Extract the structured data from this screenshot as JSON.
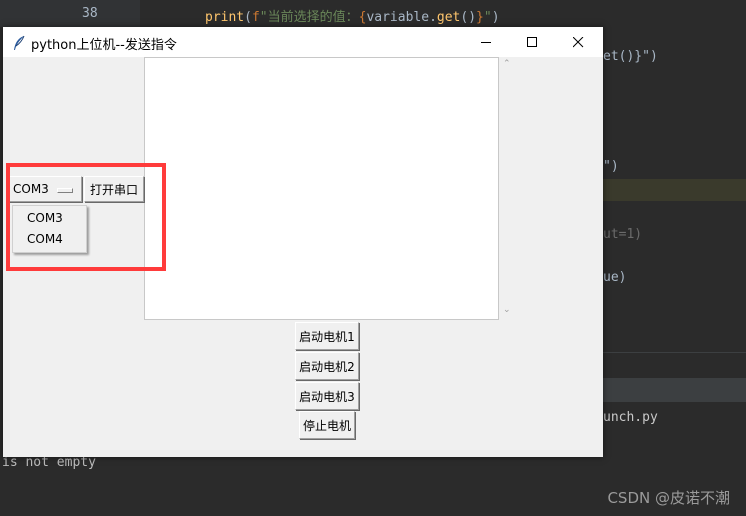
{
  "ide": {
    "line_number": "38",
    "code_top": {
      "fn": "print",
      "open": "(",
      "fprefix": "f",
      "str_open": "\"当前选择的值：",
      "brace_l": "{",
      "var": "variable",
      "dot": ".",
      "meth": "get",
      "call": "()",
      "brace_r": "}",
      "str_close": "\"",
      "close": ")"
    },
    "code_right_1": "et()}\")",
    "code_right_2": "\")",
    "code_right_3": "ut=1)",
    "code_right_4": "ue)",
    "code_right_5": "unch.py",
    "terminal_text": "is not empty"
  },
  "window": {
    "title": "python上位机--发送指令",
    "minimize_icon": "minimize-icon",
    "maximize_icon": "maximize-icon",
    "close_icon": "close-icon"
  },
  "serial": {
    "selected_port": "COM3",
    "open_button": "打开串口",
    "options": [
      "COM3",
      "COM4"
    ]
  },
  "motors": {
    "start1": "启动电机1",
    "start2": "启动电机2",
    "start3": "启动电机3",
    "stop": "停止电机"
  },
  "scroll": {
    "up": "⌃",
    "down": "⌄"
  },
  "watermark": "CSDN @皮诺不潮",
  "colors": {
    "highlight_box": "#ff3b3b",
    "window_bg": "#f0f0f0",
    "ide_bg": "#2b2b2b"
  }
}
